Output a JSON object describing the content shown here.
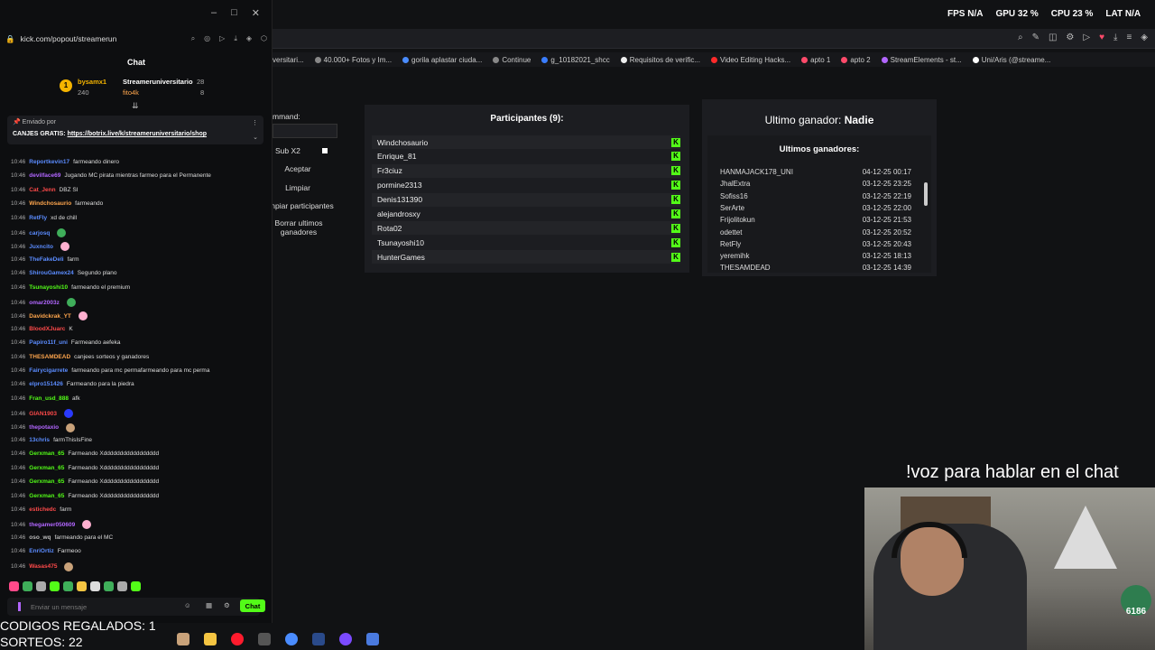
{
  "stats": {
    "fps_label": "FPS",
    "fps": "N/A",
    "gpu_label": "GPU",
    "gpu": "32 %",
    "cpu_label": "CPU",
    "cpu": "23 %",
    "lat_label": "LAT",
    "lat": "N/A"
  },
  "popout": {
    "url": "kick.com/popout/streamerun",
    "chat_title": "Chat",
    "leaders": [
      {
        "name": "bysamx1",
        "value": "240"
      },
      {
        "name": "Streameruniversitario",
        "value": "28"
      },
      {
        "name": "fito4k",
        "value": "8"
      }
    ],
    "pinned_by": "Enviado por",
    "pinned_text": "CANJES GRATIS:",
    "pinned_link": "https://botrix.live/k/streameruniversitario/shop",
    "input_placeholder": "Enviar un mensaje",
    "send_label": "Chat"
  },
  "messages": [
    {
      "time": "10:46",
      "user": "Reportkevin17",
      "color": "#5b8cff",
      "text": "farmeando dinero"
    },
    {
      "time": "10:46",
      "user": "devilface69",
      "color": "#b266ff",
      "text": "Jugando MC pirata mientras farmeo para el Permanente"
    },
    {
      "time": "10:46",
      "user": "Cat_Jenn",
      "color": "#ff4a4a",
      "text": "DBZ SI"
    },
    {
      "time": "10:46",
      "user": "Windchosaurio",
      "color": "#ffa64d",
      "text": "farmeando"
    },
    {
      "time": "10:46",
      "user": "RetFly",
      "color": "#5b8cff",
      "text": "xd de chill"
    },
    {
      "time": "10:46",
      "user": "carjosq",
      "color": "#5b8cff",
      "text": ""
    },
    {
      "time": "10:46",
      "user": "Juxncito",
      "color": "#5b8cff",
      "text": ""
    },
    {
      "time": "10:46",
      "user": "TheFakeDeli",
      "color": "#5b8cff",
      "text": "farm"
    },
    {
      "time": "10:46",
      "user": "ShirouGamex24",
      "color": "#5b8cff",
      "text": "Segundo plano"
    },
    {
      "time": "10:46",
      "user": "Tsunayoshi10",
      "color": "#53fc18",
      "text": "farmeando el premium"
    },
    {
      "time": "10:46",
      "user": "omar2003z",
      "color": "#b266ff",
      "text": ""
    },
    {
      "time": "10:46",
      "user": "Davidckrak_YT",
      "color": "#ffa64d",
      "text": ""
    },
    {
      "time": "10:46",
      "user": "BloodXJuarc",
      "color": "#ff4a4a",
      "text": "K"
    },
    {
      "time": "10:46",
      "user": "Papiro11f_uni",
      "color": "#5b8cff",
      "text": "Farmeando aefeka"
    },
    {
      "time": "10:46",
      "user": "THESAMDEAD",
      "color": "#ffa64d",
      "text": "canjees sorteos y ganadores"
    },
    {
      "time": "10:46",
      "user": "Fairycigarrete",
      "color": "#5b8cff",
      "text": "farmeando para mc permafarmeando para mc perma"
    },
    {
      "time": "10:46",
      "user": "elpro151426",
      "color": "#5b8cff",
      "text": "Farmeando para la piedra"
    },
    {
      "time": "10:46",
      "user": "Fran_usd_888",
      "color": "#53fc18",
      "text": "afk"
    },
    {
      "time": "10:46",
      "user": "GIAN1903",
      "color": "#ff4a4a",
      "text": ""
    },
    {
      "time": "10:46",
      "user": "thepotaxio",
      "color": "#b266ff",
      "text": ""
    },
    {
      "time": "10:46",
      "user": "13chris",
      "color": "#5b8cff",
      "text": "farmThisIsFine"
    },
    {
      "time": "10:46",
      "user": "Gerxman_65",
      "color": "#53fc18",
      "text": "Farmeando Xddddddddddddddddd"
    },
    {
      "time": "10:46",
      "user": "Gerxman_65",
      "color": "#53fc18",
      "text": "Farmeando Xddddddddddddddddd"
    },
    {
      "time": "10:46",
      "user": "Gerxman_65",
      "color": "#53fc18",
      "text": "Farmeando Xddddddddddddddddd"
    },
    {
      "time": "10:46",
      "user": "Gerxman_65",
      "color": "#53fc18",
      "text": "Farmeando Xddddddddddddddddd"
    },
    {
      "time": "10:46",
      "user": "estichedc",
      "color": "#ff4a4a",
      "text": "farm"
    },
    {
      "time": "10:46",
      "user": "thegamer050609",
      "color": "#b266ff",
      "text": ""
    },
    {
      "time": "10:46",
      "user": "oso_wq",
      "color": "#bbbbbb",
      "text": "farmeando para el MC"
    },
    {
      "time": "10:46",
      "user": "EnriOrtiz",
      "color": "#5b8cff",
      "text": "Farmeoo"
    },
    {
      "time": "10:46",
      "user": "Wasas475",
      "color": "#ff4a4a",
      "text": ""
    }
  ],
  "bookmarks": [
    "versitari...",
    "40.000+ Fotos y Im...",
    "gorila aplastar ciuda...",
    "Continue",
    "g_10182021_shcc",
    "Requisitos de verific...",
    "Video Editing Hacks...",
    "apto 1",
    "apto 2",
    "StreamElements - st...",
    "Uni/Aris (@streame..."
  ],
  "app": {
    "command_label": "mmand:",
    "sub_label": "Sub X2",
    "accept": "Aceptar",
    "clear": "Limpiar",
    "clear_participants": "npiar participantes",
    "clear_winners": "Borrar ultimos ganadores",
    "participants_title": "Participantes (9):",
    "participants": [
      "Windchosaurio",
      "Enrique_81",
      "Fr3ciuz",
      "pormine2313",
      "Denis131390",
      "alejandrosxy",
      "Rota02",
      "Tsunayoshi10",
      "HunterGames"
    ],
    "last_winner_label": "Ultimo ganador:",
    "last_winner": "Nadie",
    "winners_title": "Ultimos ganadores:",
    "winners": [
      {
        "name": "HANMAJACK178_UNI",
        "date": "04-12-25 00:17"
      },
      {
        "name": "JhalExtra",
        "date": "03-12-25 23:25"
      },
      {
        "name": "Sofiss16",
        "date": "03-12-25 22:19"
      },
      {
        "name": "SerArte",
        "date": "03-12-25 22:00"
      },
      {
        "name": "Frijolitokun",
        "date": "03-12-25 21:53"
      },
      {
        "name": "odettet",
        "date": "03-12-25 20:52"
      },
      {
        "name": "RetFly",
        "date": "03-12-25 20:43"
      },
      {
        "name": "yeremihk",
        "date": "03-12-25 18:13"
      },
      {
        "name": "THESAMDEAD",
        "date": "03-12-25 14:39"
      }
    ]
  },
  "overlay": {
    "voz": "!voz para hablar en el chat",
    "codes": "CODIGOS REGALADOS: 1",
    "raffles": "SORTEOS: 22",
    "cam_badge": "6186"
  }
}
